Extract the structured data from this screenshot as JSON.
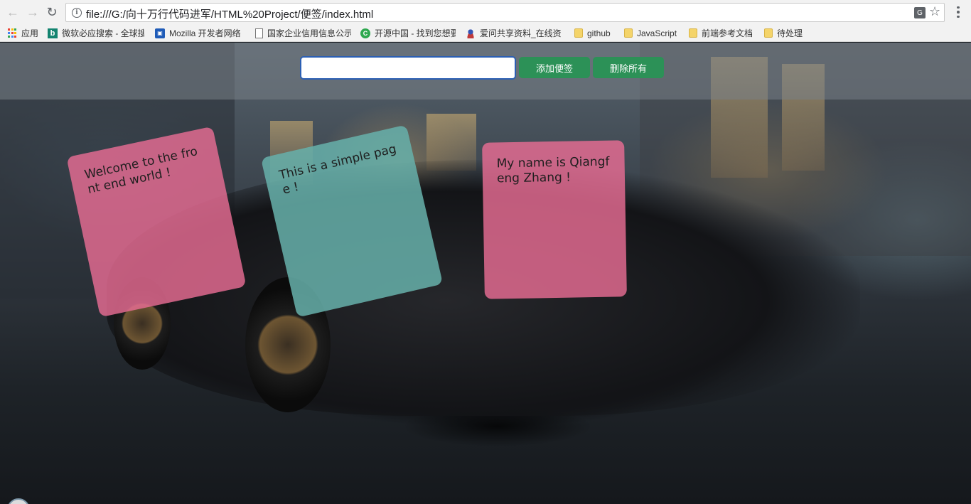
{
  "browser": {
    "url": "file:///G:/向十万行代码进军/HTML%20Project/便签/index.html",
    "bookmarks": [
      {
        "icon": "apps-icon",
        "label": "应用"
      },
      {
        "icon": "bing-icon",
        "label": "微软必应搜索 - 全球搜"
      },
      {
        "icon": "mdn-icon",
        "label": "Mozilla 开发者网络"
      },
      {
        "icon": "page-icon",
        "label": "国家企业信用信息公示"
      },
      {
        "icon": "oschina-icon",
        "label": "开源中国 - 找到您想要"
      },
      {
        "icon": "person-icon",
        "label": "爱问共享资料_在线资"
      },
      {
        "icon": "folder-icon",
        "label": "github"
      },
      {
        "icon": "folder-icon",
        "label": "JavaScript"
      },
      {
        "icon": "folder-icon",
        "label": "前端参考文档"
      },
      {
        "icon": "folder-icon",
        "label": "待处理"
      }
    ]
  },
  "app": {
    "input_value": "",
    "add_button": "添加便签",
    "delete_all_button": "删除所有",
    "notes": [
      {
        "text": "Welcome to the front end world !",
        "color": "#e86c94"
      },
      {
        "text": "This is a simple page !",
        "color": "#66b0aa"
      },
      {
        "text": "My name is Qiangfeng Zhang !",
        "color": "#e86c94"
      }
    ]
  }
}
